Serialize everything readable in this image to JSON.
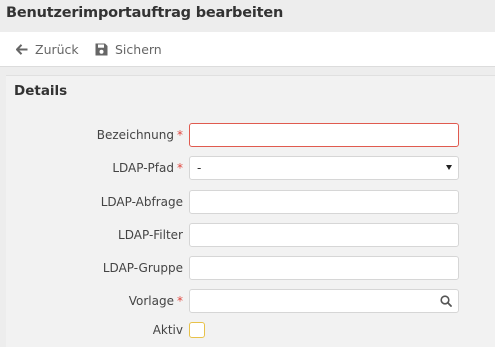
{
  "window": {
    "title": "Benutzerimportauftrag bearbeiten"
  },
  "toolbar": {
    "back_label": "Zurück",
    "back_icon": "arrow-left-icon",
    "save_label": "Sichern",
    "save_icon": "floppy-disk-icon"
  },
  "panel": {
    "title": "Details",
    "required_marker": "*",
    "fields": {
      "name": {
        "label": "Bezeichnung",
        "required": true,
        "value": ""
      },
      "ldap_path": {
        "label": "LDAP-Pfad",
        "required": true,
        "value": "-"
      },
      "ldap_query": {
        "label": "LDAP-Abfrage",
        "value": ""
      },
      "ldap_filter": {
        "label": "LDAP-Filter",
        "value": ""
      },
      "ldap_group": {
        "label": "LDAP-Gruppe",
        "value": ""
      },
      "template": {
        "label": "Vorlage",
        "required": true,
        "value": ""
      },
      "active": {
        "label": "Aktiv",
        "checked": false
      }
    }
  },
  "colors": {
    "required": "#e0463d",
    "invalid_border": "#e05a4f",
    "checkbox_border": "#e8c24a"
  }
}
